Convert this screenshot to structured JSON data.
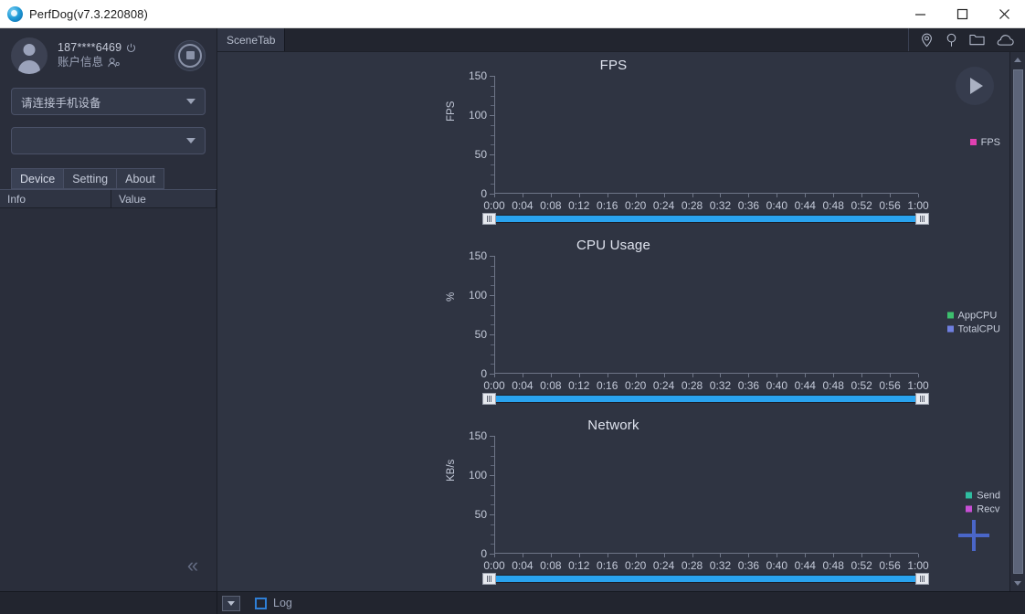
{
  "window": {
    "title": "PerfDog(v7.3.220808)",
    "logo_icon": "perfdog-logo-icon",
    "controls": [
      {
        "name": "minimize",
        "glyph": "minimize-icon"
      },
      {
        "name": "maximize",
        "glyph": "maximize-icon"
      },
      {
        "name": "close",
        "glyph": "close-icon"
      }
    ]
  },
  "sidebar": {
    "account": {
      "avatar_icon": "avatar-icon",
      "id": "187****6469",
      "power_icon": "power-icon",
      "sub_label": "账户信息",
      "user_config_icon": "user-config-icon",
      "record_button_icon": "stop-record-icon"
    },
    "device_combo": {
      "value": "请连接手机设备",
      "arrow_icon": "chevron-down-icon"
    },
    "app_combo": {
      "value": "",
      "arrow_icon": "chevron-down-icon"
    },
    "tabs": [
      {
        "label": "Device",
        "active": true
      },
      {
        "label": "Setting",
        "active": false
      },
      {
        "label": "About",
        "active": false
      }
    ],
    "table": {
      "columns": [
        "Info",
        "Value"
      ],
      "rows": []
    },
    "collapse_icon": "chevron-double-left-icon",
    "collapse_glyph": "«"
  },
  "main": {
    "tabs": [
      {
        "label": "SceneTab",
        "active": true
      }
    ],
    "tool_icons": [
      {
        "name": "location-pin-icon"
      },
      {
        "name": "marker-pin-icon"
      },
      {
        "name": "folder-icon"
      },
      {
        "name": "cloud-icon"
      }
    ],
    "play_button_icon": "play-icon",
    "add_button_icon": "plus-icon",
    "scroll_left_grip_icon": "range-grip-left-icon",
    "scroll_right_grip_icon": "range-grip-right-icon"
  },
  "bottom": {
    "dropdown_icon": "chevron-down-icon",
    "log_checkbox_checked": false,
    "log_label": "Log"
  },
  "colors": {
    "background": "#2a2e3b",
    "panel": "#2f3442",
    "accent_blue": "#29a3ef",
    "plus_blue": "#4a66c8",
    "fps": "#e040b0",
    "appcpu": "#3dbf6e",
    "totalcpu": "#6f7fe0",
    "send": "#2fbda0",
    "recv": "#c84fd6"
  },
  "chart_data": [
    {
      "type": "line",
      "title": "FPS",
      "xlabel": "",
      "ylabel": "FPS",
      "ylim": [
        0,
        150
      ],
      "yticks": [
        0,
        50,
        100,
        150
      ],
      "xticks": [
        "0:00",
        "0:04",
        "0:08",
        "0:12",
        "0:16",
        "0:20",
        "0:24",
        "0:28",
        "0:32",
        "0:36",
        "0:40",
        "0:44",
        "0:48",
        "0:52",
        "0:56",
        "1:00"
      ],
      "grid": false,
      "legend_position": "right",
      "series": [
        {
          "name": "FPS",
          "color": "#e040b0",
          "values": []
        }
      ]
    },
    {
      "type": "line",
      "title": "CPU Usage",
      "xlabel": "",
      "ylabel": "%",
      "ylim": [
        0,
        150
      ],
      "yticks": [
        0,
        50,
        100,
        150
      ],
      "xticks": [
        "0:00",
        "0:04",
        "0:08",
        "0:12",
        "0:16",
        "0:20",
        "0:24",
        "0:28",
        "0:32",
        "0:36",
        "0:40",
        "0:44",
        "0:48",
        "0:52",
        "0:56",
        "1:00"
      ],
      "grid": false,
      "legend_position": "right",
      "series": [
        {
          "name": "AppCPU",
          "color": "#3dbf6e",
          "values": []
        },
        {
          "name": "TotalCPU",
          "color": "#6f7fe0",
          "values": []
        }
      ]
    },
    {
      "type": "line",
      "title": "Network",
      "xlabel": "",
      "ylabel": "KB/s",
      "ylim": [
        0,
        150
      ],
      "yticks": [
        0,
        50,
        100,
        150
      ],
      "xticks": [
        "0:00",
        "0:04",
        "0:08",
        "0:12",
        "0:16",
        "0:20",
        "0:24",
        "0:28",
        "0:32",
        "0:36",
        "0:40",
        "0:44",
        "0:48",
        "0:52",
        "0:56",
        "1:00"
      ],
      "grid": false,
      "legend_position": "right",
      "series": [
        {
          "name": "Send",
          "color": "#2fbda0",
          "values": []
        },
        {
          "name": "Recv",
          "color": "#c84fd6",
          "values": []
        }
      ]
    }
  ]
}
